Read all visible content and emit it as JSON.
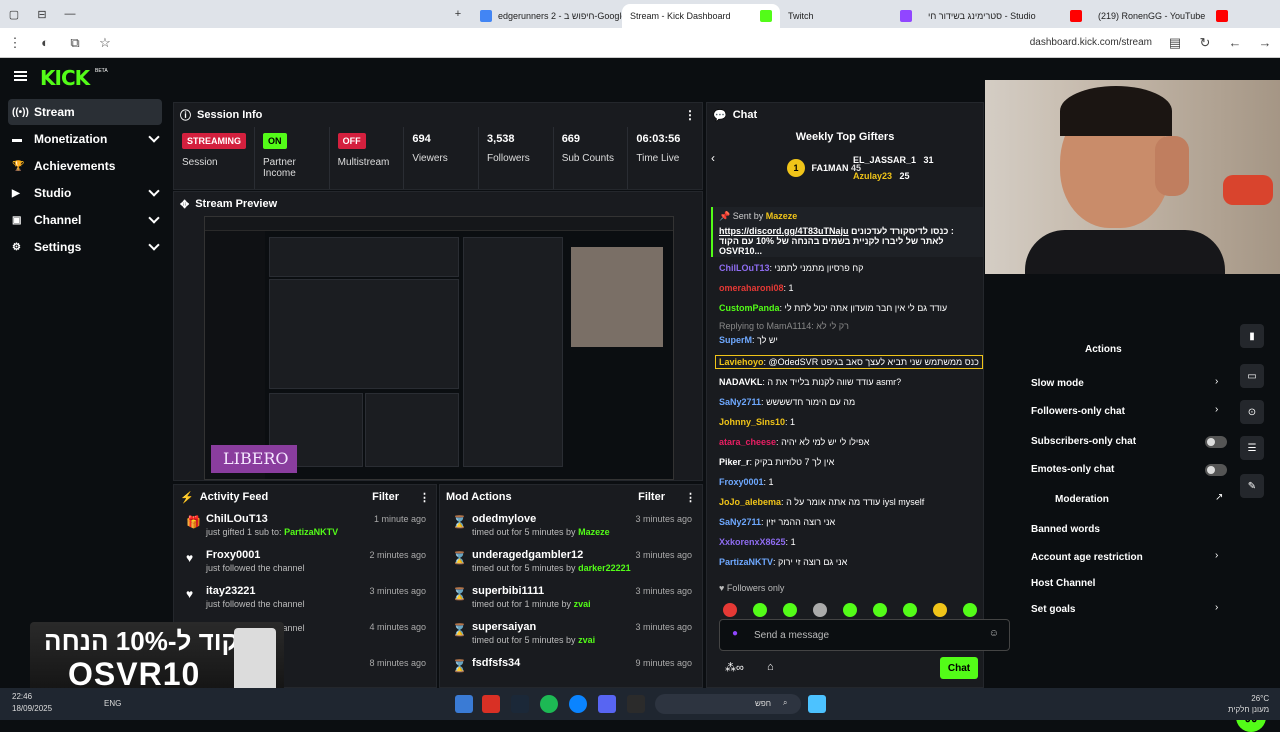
{
  "browser": {
    "tabs": [
      {
        "label": "edgerunners 2 - חיפוש ב-Google",
        "color": "#4285f4"
      },
      {
        "label": "Stream - Kick Dashboard",
        "color": "#53fc18"
      },
      {
        "label": "Twitch",
        "color": "#9146ff"
      },
      {
        "label": "סטרימינג בשידור חי - Studio",
        "color": "#ff0000"
      },
      {
        "label": "(219) RonenGG - YouTube",
        "color": "#ff0000"
      }
    ],
    "url": "dashboard.kick.com/stream"
  },
  "logo": "KICK",
  "logo_badge": "BETA",
  "sidebar": [
    {
      "label": "Stream",
      "icon": "stream-icon",
      "glyph": "((•))",
      "active": true,
      "chevron": false
    },
    {
      "label": "Monetization",
      "icon": "monetization-icon",
      "glyph": "▬",
      "active": false,
      "chevron": true
    },
    {
      "label": "Achievements",
      "icon": "trophy-icon",
      "glyph": "🏆",
      "active": false,
      "chevron": false
    },
    {
      "label": "Studio",
      "icon": "studio-icon",
      "glyph": "▶",
      "active": false,
      "chevron": true
    },
    {
      "label": "Channel",
      "icon": "channel-icon",
      "glyph": "▣",
      "active": false,
      "chevron": true
    },
    {
      "label": "Settings",
      "icon": "gear-icon",
      "glyph": "⚙",
      "active": false,
      "chevron": true
    }
  ],
  "session": {
    "title": "Session Info",
    "status_badge": "STREAMING",
    "status_label": "Session",
    "partner_badge": "ON",
    "partner_label": "Partner Income",
    "multistream_badge": "OFF",
    "multistream_label": "Multistream",
    "viewers": "694",
    "viewers_label": "Viewers",
    "followers": "3,538",
    "followers_label": "Followers",
    "subs": "669",
    "subs_label": "Sub Counts",
    "time_live": "06:03:56",
    "time_live_label": "Time Live"
  },
  "preview": {
    "title": "Stream Preview",
    "overlay_text": "LIBERO"
  },
  "activity": {
    "title": "Activity Feed",
    "filter": "Filter",
    "items": [
      {
        "name": "ChilLOuT13",
        "action": "just gifted 1 sub to:",
        "target": "PartizaNKTV",
        "time": "1 minute ago",
        "icon": "gift-icon",
        "glyph": "🎁"
      },
      {
        "name": "Froxy0001",
        "action": "just followed the channel",
        "target": "",
        "time": "2 minutes ago",
        "icon": "heart-icon",
        "glyph": "♥"
      },
      {
        "name": "itay23221",
        "action": "just followed the channel",
        "target": "",
        "time": "3 minutes ago",
        "icon": "heart-icon",
        "glyph": "♥"
      },
      {
        "name": "",
        "action": "just followed the channel",
        "target": "",
        "time": "4 minutes ago",
        "icon": "heart-icon",
        "glyph": "♥"
      },
      {
        "name": "",
        "action": "",
        "target": "",
        "time": "8 minutes ago",
        "icon": "heart-icon",
        "glyph": "♥"
      }
    ]
  },
  "mod": {
    "title": "Mod Actions",
    "filter": "Filter",
    "items": [
      {
        "name": "odedmylove",
        "action": "timed out for 5 minutes by",
        "by": "Mazeze",
        "time": "3 minutes ago",
        "by_color": "#53fc18"
      },
      {
        "name": "underagedgambler12",
        "action": "timed out for 5 minutes by",
        "by": "darker22221",
        "time": "3 minutes ago",
        "by_color": "#53fc18"
      },
      {
        "name": "superbibi1111",
        "action": "timed out for 1 minute by",
        "by": "zvai",
        "time": "3 minutes ago",
        "by_color": "#53fc18"
      },
      {
        "name": "supersaiyan",
        "action": "timed out for 5 minutes by",
        "by": "zvai",
        "time": "3 minutes ago",
        "by_color": "#53fc18"
      },
      {
        "name": "fsdfsfs34",
        "action": "",
        "by": "",
        "time": "9 minutes ago",
        "by_color": "#53fc18"
      }
    ]
  },
  "chat": {
    "title": "Chat",
    "gifters_title": "Weekly Top Gifters",
    "gifters": [
      {
        "name": "FA1MAN",
        "count": "45",
        "color": "#53fc18"
      },
      {
        "name": "EL_JASSAR_1",
        "count": "31",
        "color": "#ffffff"
      },
      {
        "name": "Azulay23",
        "count": "25",
        "color": "#f0c419"
      }
    ],
    "pinned_by_label": "Sent by",
    "pinned_by": "Mazeze",
    "pinned_link": "https://discord.gg/4T83uTNaju",
    "pinned_line1": "כנסו לדיסקורד לעדכונים :",
    "pinned_line2": "לאתר של ליברו לקניית בשמים בהנחה של 10% עם הקוד OSVR10...",
    "messages": [
      {
        "user": "ChilLOuT13",
        "text": "קח פרסיון מתמני לתמני",
        "color": "#8e6cf0"
      },
      {
        "user": "omeraharoni08",
        "text": "1",
        "color": "#e53935"
      },
      {
        "user": "CustomPanda",
        "text": "עודד גם לי אין חבר מועדון אתה יכול לתת לי",
        "color": "#53fc18"
      },
      {
        "user": "Replying to MamA1114:",
        "text": "רק לי לא",
        "color": "#888888"
      },
      {
        "user": "SuperM",
        "text": "יש לך",
        "color": "#6ea8fe"
      },
      {
        "user": "Laviehoyo",
        "text": "@OdedSVR כנס ממשתמש שני תביא לעצך סאב בגיפט",
        "color": "#f0c419"
      },
      {
        "user": "NADAVKL",
        "text": "עודד שווה לקנות בלייד את ה asmr?",
        "color": "#ffffff"
      },
      {
        "user": "SaNy2711",
        "text": "מה עם הימור חדשששש",
        "color": "#6ea8fe"
      },
      {
        "user": "Johnny_Sins10",
        "text": "1",
        "color": "#f0c419"
      },
      {
        "user": "atara_cheese",
        "text": "אפילו לי יש למי לא יהיה",
        "color": "#e91e63"
      },
      {
        "user": "Piker_r",
        "text": "אין לך 7 טלוזיות בקיק",
        "color": "#ffffff"
      },
      {
        "user": "Froxy0001",
        "text": "1",
        "color": "#6ea8fe"
      },
      {
        "user": "JoJo_alebema",
        "text": "עודד מה אתה אומר על ה iysl myself",
        "color": "#f0c419"
      },
      {
        "user": "SaNy2711",
        "text": "אני רוצה ההמר יזין",
        "color": "#6ea8fe"
      },
      {
        "user": "XxkorenxX8625",
        "text": "1",
        "color": "#8e6cf0"
      },
      {
        "user": "PartizaNKTV",
        "text": "אני גם רוצה זי ירוק",
        "color": "#6ea8fe"
      }
    ],
    "followers_only": "Followers only",
    "input_placeholder": "Send a message",
    "send_label": "Chat"
  },
  "mod_menu": {
    "actions": "Actions",
    "slow_mode": "Slow mode",
    "followers_only": "Followers-only chat",
    "subscribers_only": "Subscribers-only chat",
    "emotes_only": "Emotes-only chat",
    "moderation": "Moderation",
    "banned_words": "Banned words",
    "account_age": "Account age restriction",
    "host_channel": "Host Channel",
    "set_goals": "Set goals"
  },
  "promo": {
    "line1": "קוד ל-10% הנחה",
    "line2": "OSVR10"
  },
  "taskbar": {
    "time": "22:46",
    "date": "18/09/2025",
    "lang": "ENG",
    "search": "חפש",
    "weather": "26°C",
    "weather_desc": "מעונן חלקית"
  }
}
